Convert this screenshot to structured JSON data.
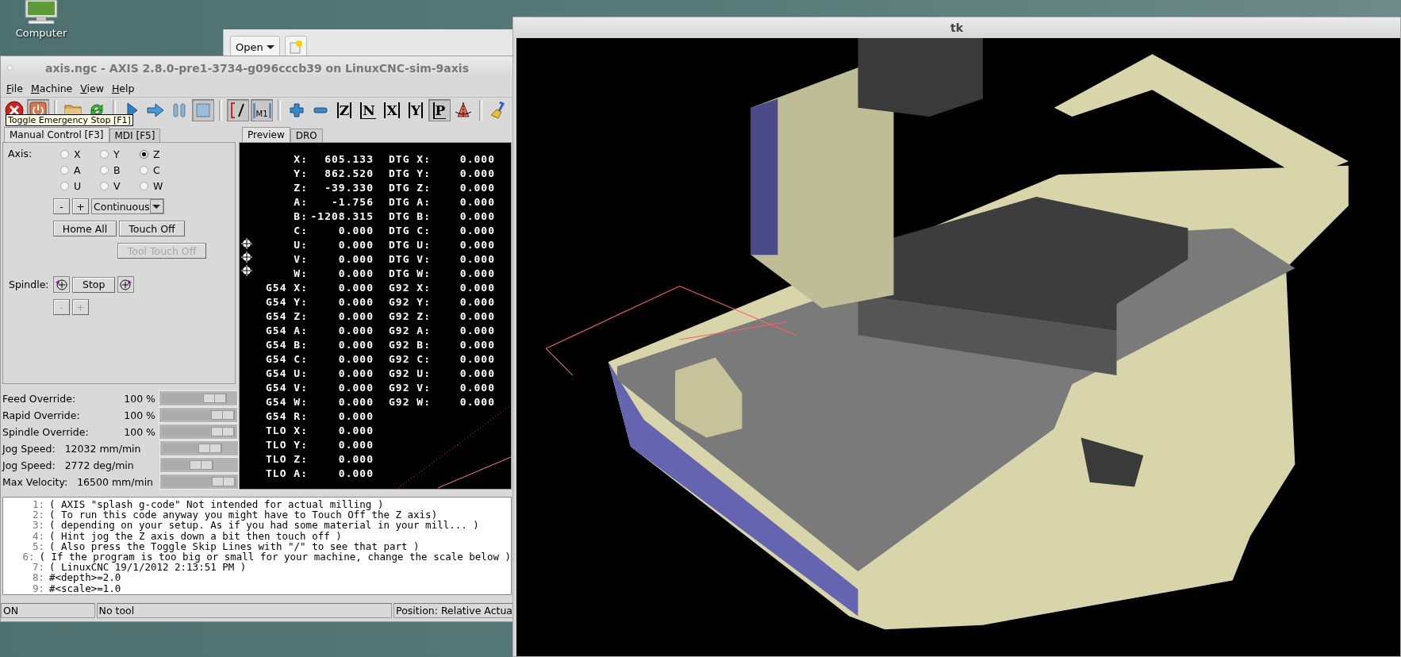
{
  "desktop": {
    "icons": [
      {
        "label": "Computer"
      }
    ]
  },
  "file_window": {
    "open_button": "Open"
  },
  "axis_window": {
    "title": "axis.ngc - AXIS 2.8.0-pre1-3734-g096cccb39 on LinuxCNC-sim-9axis",
    "menu": [
      "File",
      "Machine",
      "View",
      "Help"
    ],
    "toolbar": [
      {
        "kind": "estop",
        "pressed": false
      },
      {
        "kind": "power",
        "pressed": true
      },
      {
        "kind": "separator"
      },
      {
        "kind": "open",
        "pressed": false
      },
      {
        "kind": "reload",
        "pressed": false
      },
      {
        "kind": "separator"
      },
      {
        "kind": "run",
        "pressed": false
      },
      {
        "kind": "step",
        "pressed": false
      },
      {
        "kind": "pause",
        "pressed": false
      },
      {
        "kind": "stop",
        "pressed": true
      },
      {
        "kind": "separator"
      },
      {
        "kind": "skip",
        "pressed": true
      },
      {
        "kind": "optional_stop",
        "glyph": "M1",
        "pressed": true
      },
      {
        "kind": "separator"
      },
      {
        "kind": "zoom_in",
        "pressed": false
      },
      {
        "kind": "zoom_out",
        "pressed": false
      },
      {
        "kind": "view",
        "glyph": "Z",
        "pressed": false
      },
      {
        "kind": "view_rotated",
        "glyph": "N",
        "pressed": false
      },
      {
        "kind": "view",
        "glyph": "X",
        "pressed": false
      },
      {
        "kind": "view",
        "glyph": "Y",
        "pressed": false
      },
      {
        "kind": "view_rotated",
        "glyph": "P",
        "pressed": true
      },
      {
        "kind": "rotate",
        "pressed": false
      },
      {
        "kind": "separator"
      },
      {
        "kind": "clear",
        "pressed": false
      }
    ],
    "tooltip": "Toggle Emergency Stop [F1]",
    "left_tabs": [
      {
        "label": "Manual Control [F3]",
        "selected": true
      },
      {
        "label": "MDI [F5]",
        "selected": false
      }
    ],
    "manual_control": {
      "axis_label": "Axis:",
      "axes": [
        {
          "label": "X",
          "selected": false
        },
        {
          "label": "Y",
          "selected": false
        },
        {
          "label": "Z",
          "selected": true
        },
        {
          "label": "A",
          "selected": false
        },
        {
          "label": "B",
          "selected": false
        },
        {
          "label": "C",
          "selected": false
        },
        {
          "label": "U",
          "selected": false
        },
        {
          "label": "V",
          "selected": false
        },
        {
          "label": "W",
          "selected": false
        }
      ],
      "jog_minus": "-",
      "jog_plus": "+",
      "jog_increment": "Continuous",
      "buttons": [
        {
          "label": "Home All",
          "disabled": false
        },
        {
          "label": "Touch Off",
          "disabled": false
        },
        {
          "label": "Tool Touch Off",
          "disabled": true
        }
      ],
      "spindle_label": "Spindle:",
      "spindle_stop": "Stop",
      "spindle_adjust": [
        {
          "label": "-",
          "disabled": true
        },
        {
          "label": "+",
          "disabled": true
        }
      ]
    },
    "sliders": [
      {
        "kind": "override",
        "label": "Feed Override:",
        "reading": "100 %",
        "level": 0.89
      },
      {
        "kind": "override",
        "label": "Rapid Override:",
        "reading": "100 %",
        "level": 1.0
      },
      {
        "kind": "override",
        "label": "Spindle Override:",
        "reading": "100 %",
        "level": 1.0
      },
      {
        "kind": "speed",
        "label": "Jog Speed:",
        "reading": "12032 mm/min",
        "level": 0.82
      },
      {
        "kind": "speed",
        "label": "Jog Speed:",
        "reading": "2772 deg/min",
        "level": 0.7
      },
      {
        "kind": "speed",
        "label": "Max Velocity:",
        "reading": "16500 mm/min",
        "level": 1.0
      }
    ],
    "right_tabs": [
      {
        "label": "Preview",
        "selected": true
      },
      {
        "label": "DRO",
        "selected": false
      }
    ],
    "dro": {
      "rows": [
        {
          "label": "X:",
          "value": "605.133",
          "label_2": "DTG X:",
          "value_2": "0.000"
        },
        {
          "label": "Y:",
          "value": "862.520",
          "label_2": "DTG Y:",
          "value_2": "0.000"
        },
        {
          "label": "Z:",
          "value": "-39.330",
          "label_2": "DTG Z:",
          "value_2": "0.000"
        },
        {
          "label": "A:",
          "value": "-1.756",
          "label_2": "DTG A:",
          "value_2": "0.000"
        },
        {
          "label": "B:",
          "value": "-1208.315",
          "label_2": "DTG B:",
          "value_2": "0.000"
        },
        {
          "label": "C:",
          "value": "0.000",
          "label_2": "DTG C:",
          "value_2": "0.000"
        },
        {
          "label": "U:",
          "value": "0.000",
          "label_2": "DTG U:",
          "value_2": "0.000"
        },
        {
          "label": "V:",
          "value": "0.000",
          "label_2": "DTG V:",
          "value_2": "0.000"
        },
        {
          "label": "W:",
          "value": "0.000",
          "label_2": "DTG W:",
          "value_2": "0.000"
        },
        {
          "label": "G54 X:",
          "value": "0.000",
          "label_2": "G92 X:",
          "value_2": "0.000"
        },
        {
          "label": "G54 Y:",
          "value": "0.000",
          "label_2": "G92 Y:",
          "value_2": "0.000"
        },
        {
          "label": "G54 Z:",
          "value": "0.000",
          "label_2": "G92 Z:",
          "value_2": "0.000"
        },
        {
          "label": "G54 A:",
          "value": "0.000",
          "label_2": "G92 A:",
          "value_2": "0.000"
        },
        {
          "label": "G54 B:",
          "value": "0.000",
          "label_2": "G92 B:",
          "value_2": "0.000"
        },
        {
          "label": "G54 C:",
          "value": "0.000",
          "label_2": "G92 C:",
          "value_2": "0.000"
        },
        {
          "label": "G54 U:",
          "value": "0.000",
          "label_2": "G92 U:",
          "value_2": "0.000"
        },
        {
          "label": "G54 V:",
          "value": "0.000",
          "label_2": "G92 V:",
          "value_2": "0.000"
        },
        {
          "label": "G54 W:",
          "value": "0.000",
          "label_2": "G92 W:",
          "value_2": "0.000"
        },
        {
          "label": "G54 R:",
          "value": "0.000"
        },
        {
          "label": "TLO X:",
          "value": "0.000"
        },
        {
          "label": "TLO Y:",
          "value": "0.000"
        },
        {
          "label": "TLO Z:",
          "value": "0.000"
        },
        {
          "label": "TLO A:",
          "value": "0.000"
        }
      ]
    },
    "gcode": [
      {
        "number": "1:",
        "text": "( AXIS \"splash g-code\" Not intended for actual milling )"
      },
      {
        "number": "2:",
        "text": "( To run this code anyway you might have to Touch Off the Z axis)"
      },
      {
        "number": "3:",
        "text": "( depending on your setup. As if you had some material in your mill... )"
      },
      {
        "number": "4:",
        "text": "( Hint jog the Z axis down a bit then touch off )"
      },
      {
        "number": "5:",
        "text": "( Also press the Toggle Skip Lines with \"/\" to see that part )"
      },
      {
        "number": "6:",
        "text": "( If the program is too big or small for your machine, change the scale below )"
      },
      {
        "number": "7:",
        "text": "( LinuxCNC 19/1/2012 2:13:51 PM )"
      },
      {
        "number": "8:",
        "text": "#<depth>=2.0"
      },
      {
        "number": "9:",
        "text": "#<scale>=1.0"
      }
    ],
    "status_bar": [
      "ON",
      "No tool",
      "Position: Relative Actua"
    ]
  },
  "tk_window": {
    "title": "tk"
  }
}
